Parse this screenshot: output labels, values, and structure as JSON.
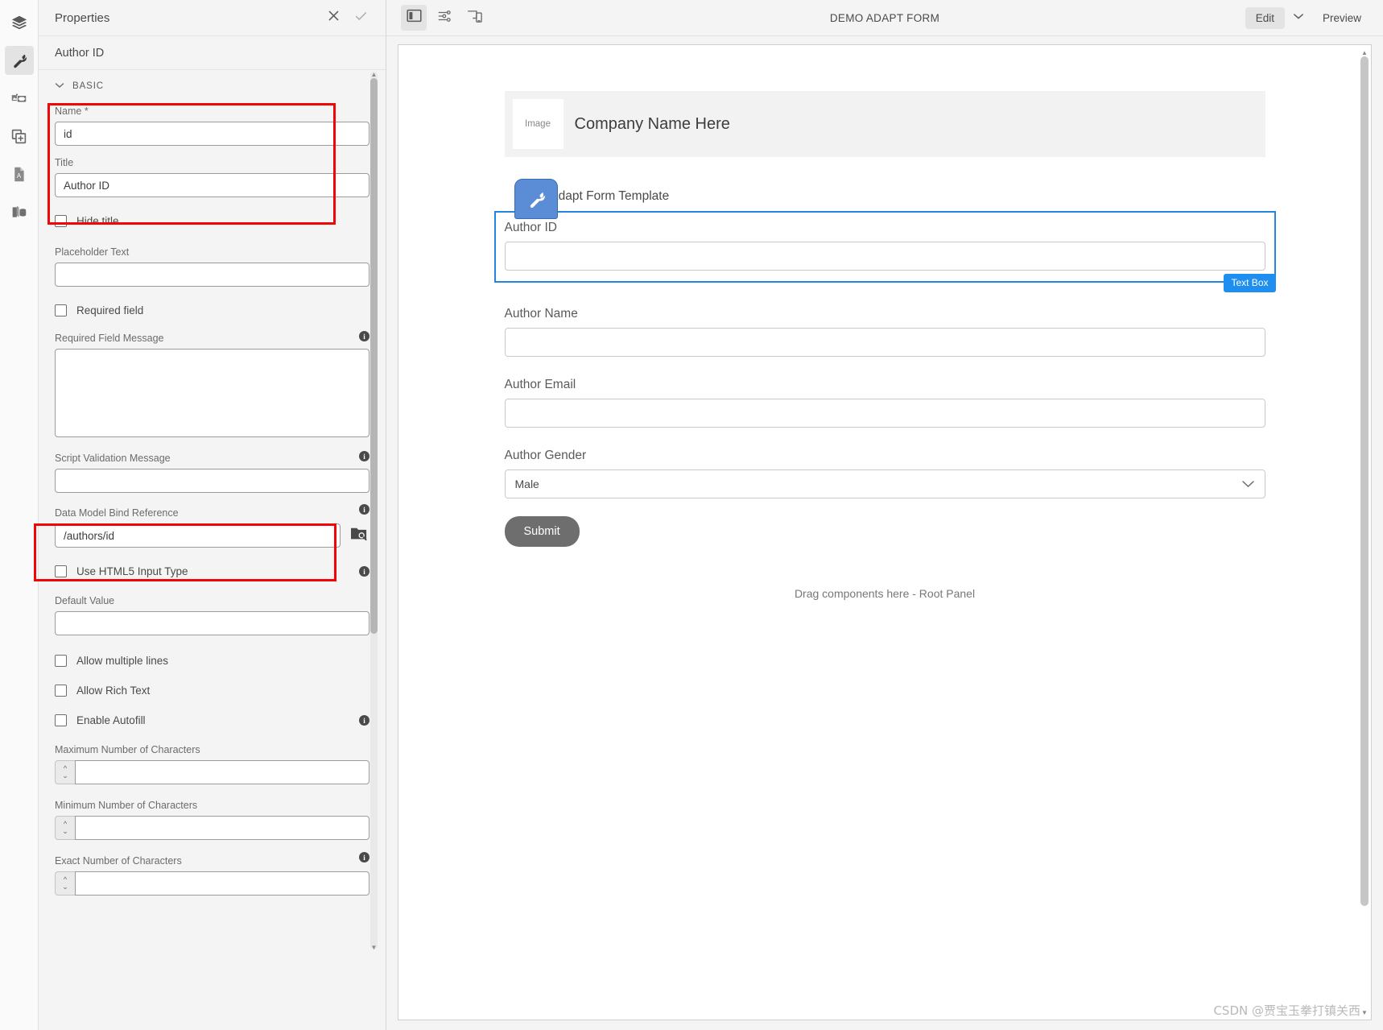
{
  "rail": {
    "items": [
      {
        "name": "layers-icon",
        "label": "Layers"
      },
      {
        "name": "wrench-icon",
        "label": "Properties"
      },
      {
        "name": "assets-icon",
        "label": "Assets"
      },
      {
        "name": "components-icon",
        "label": "Components"
      },
      {
        "name": "pdf-document-icon",
        "label": "Document"
      },
      {
        "name": "content-tree-icon",
        "label": "Content Tree"
      }
    ]
  },
  "properties": {
    "title": "Properties",
    "close_label": "×",
    "confirm_label": "✓",
    "selected_component": "Author ID",
    "section": {
      "label": "BASIC",
      "caret": "⌄"
    },
    "fields": {
      "name": {
        "label": "Name *",
        "value": "id",
        "placeholder": ""
      },
      "title": {
        "label": "Title",
        "value": "Author ID",
        "placeholder": ""
      },
      "hide_title": {
        "label": "Hide title",
        "checked": false
      },
      "placeholder_text": {
        "label": "Placeholder Text",
        "value": "",
        "placeholder": ""
      },
      "required_field": {
        "label": "Required field",
        "checked": false
      },
      "required_field_message": {
        "label": "Required Field Message",
        "value": "",
        "placeholder": ""
      },
      "script_validation_message": {
        "label": "Script Validation Message",
        "value": "",
        "placeholder": ""
      },
      "data_model_bind_reference": {
        "label": "Data Model Bind Reference",
        "value": "/authors/id",
        "placeholder": ""
      },
      "use_html5_input_type": {
        "label": "Use HTML5 Input Type",
        "checked": false
      },
      "default_value": {
        "label": "Default Value",
        "value": "",
        "placeholder": ""
      },
      "allow_multiple_lines": {
        "label": "Allow multiple lines",
        "checked": false
      },
      "allow_rich_text": {
        "label": "Allow Rich Text",
        "checked": false
      },
      "enable_autofill": {
        "label": "Enable Autofill",
        "checked": false
      },
      "max_chars": {
        "label": "Maximum Number of Characters",
        "value": "",
        "placeholder": ""
      },
      "min_chars": {
        "label": "Minimum Number of Characters",
        "value": "",
        "placeholder": ""
      },
      "exact_chars": {
        "label": "Exact Number of Characters",
        "value": "",
        "placeholder": ""
      }
    },
    "info_tooltip": "i"
  },
  "topbar": {
    "toggle_side_panel": "side-panel-toggle",
    "ruler_icon": "emulator-settings-icon",
    "device_icon": "responsive-device-icon",
    "title": "DEMO ADAPT FORM",
    "edit_label": "Edit",
    "mode_caret": "⌄",
    "preview_label": "Preview"
  },
  "canvas": {
    "company": {
      "image_label": "Image",
      "name": "Company Name Here"
    },
    "template_title": "Demo Adapt Form Template",
    "badge_textbox": "Text Box",
    "fields": [
      {
        "id": "author-id",
        "label": "Author ID",
        "type": "text",
        "value": "",
        "selected": true
      },
      {
        "id": "author-name",
        "label": "Author Name",
        "type": "text",
        "value": "",
        "selected": false
      },
      {
        "id": "author-email",
        "label": "Author Email",
        "type": "text",
        "value": "",
        "selected": false
      },
      {
        "id": "author-gender",
        "label": "Author Gender",
        "type": "select",
        "value": "Male",
        "selected": false
      }
    ],
    "submit_label": "Submit",
    "drop_hint": "Drag components here - Root Panel"
  },
  "watermark": "CSDN @贾宝玉拳打镇关西",
  "colors": {
    "accent_blue": "#2484de",
    "badge_blue": "#1e8ef0",
    "wrench_badge": "#5b8dd6",
    "annotation_red": "#f20505",
    "submit_gray": "#6e6e6e"
  }
}
